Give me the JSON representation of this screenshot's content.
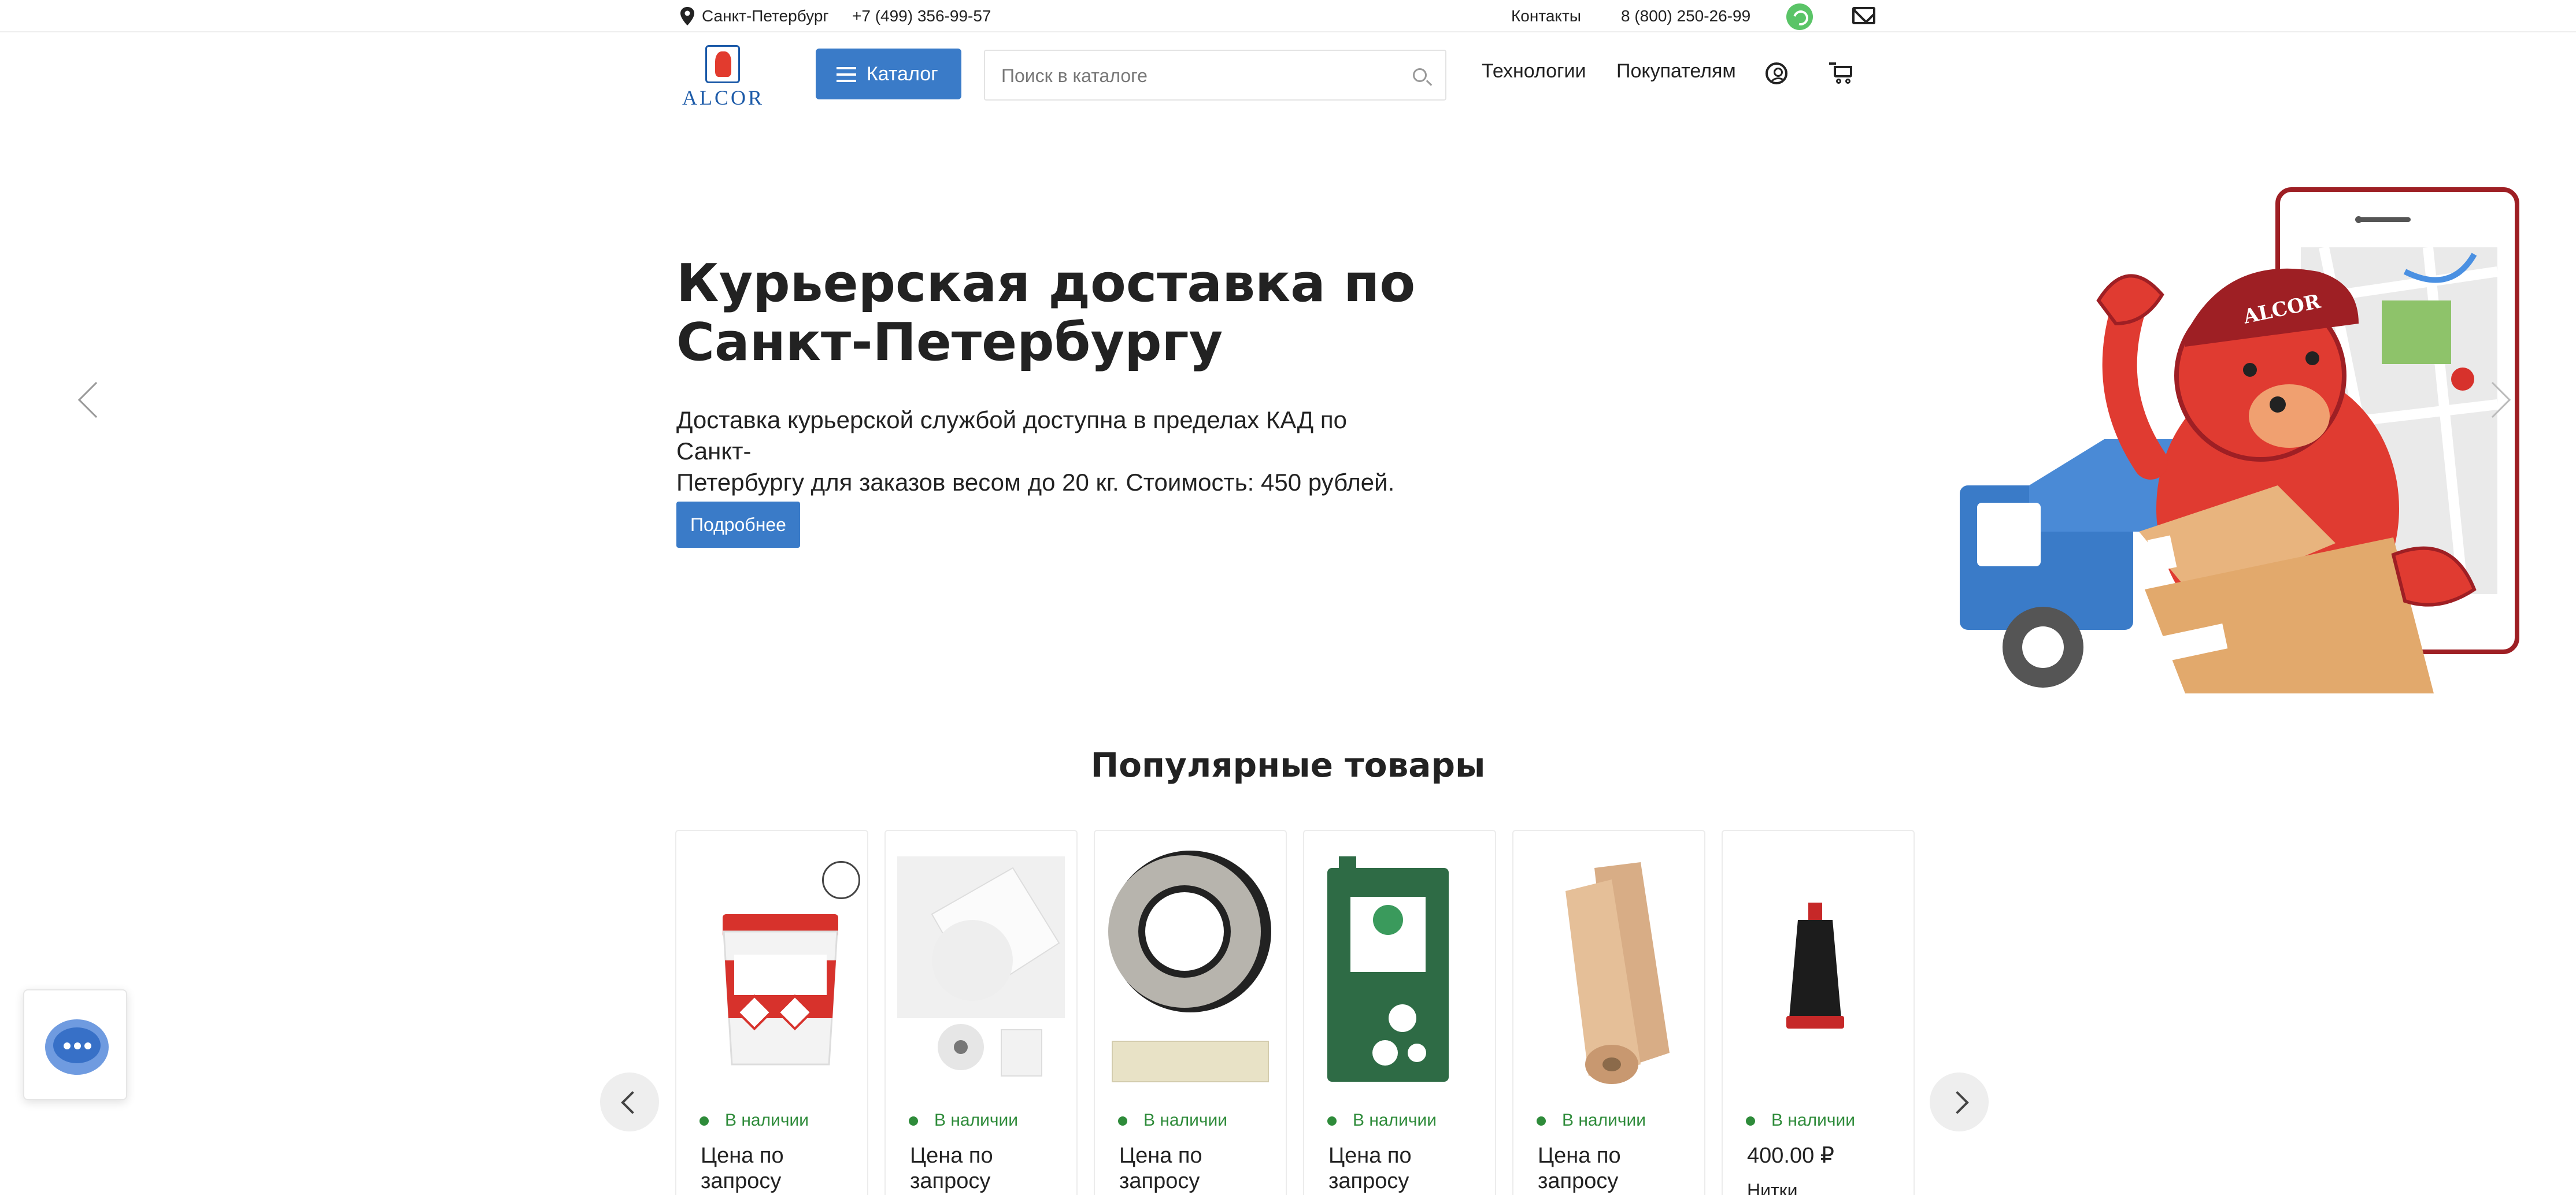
{
  "topbar": {
    "city": "Санкт-Петербург",
    "phone_city": "+7 (499) 356-99-57",
    "contacts_label": "Контакты",
    "phone_free": "8 (800) 250-26-99"
  },
  "header": {
    "logo_text": "ALCOR",
    "catalog_label": "Каталог",
    "search_placeholder": "Поиск в каталоге",
    "nav": [
      "Технологии",
      "Покупателям"
    ]
  },
  "hero": {
    "title_line1": "Курьерская доставка по",
    "title_line2": "Санкт-Петербургу",
    "desc_line1": "Доставка курьерской службой доступна в пределах КАД по Санкт-",
    "desc_line2": "Петербургу для заказов весом до 20 кг. Стоимость: 450 рублей.",
    "button_label": "Подробнее",
    "mascot_cap_text": "ALCOR"
  },
  "popular": {
    "title": "Популярные товары",
    "products": [
      {
        "stock": "В наличии",
        "price_line1": "Цена по",
        "price_line2": "запросу",
        "name": ""
      },
      {
        "stock": "В наличии",
        "price_line1": "Цена по",
        "price_line2": "запросу",
        "name": ""
      },
      {
        "stock": "В наличии",
        "price_line1": "Цена по",
        "price_line2": "запросу",
        "name": ""
      },
      {
        "stock": "В наличии",
        "price_line1": "Цена по",
        "price_line2": "запросу",
        "name": ""
      },
      {
        "stock": "В наличии",
        "price_line1": "Цена по",
        "price_line2": "запросу",
        "name": ""
      },
      {
        "stock": "В наличии",
        "price_line1": "400.00 ₽",
        "price_line2": "",
        "name": "Нитки"
      }
    ]
  },
  "icons": {
    "location": "location-pin-icon",
    "whatsapp": "whatsapp-icon",
    "mail": "mail-icon",
    "menu": "hamburger-icon",
    "search": "search-icon",
    "user": "user-icon",
    "cart": "cart-icon",
    "chat": "chat-icon"
  },
  "colors": {
    "accent": "#3a7bc8",
    "in_stock": "#2e8b3a",
    "whatsapp": "#5ac467",
    "brand_red": "#d7322c"
  }
}
